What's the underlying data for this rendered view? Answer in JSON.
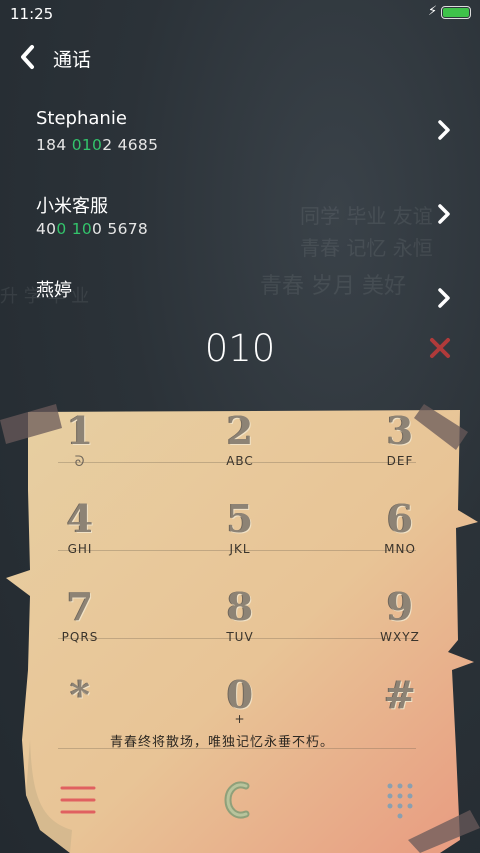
{
  "status": {
    "time": "11:25"
  },
  "header": {
    "title": "通话"
  },
  "contacts": [
    {
      "name": "Stephanie",
      "number_parts": [
        "184 ",
        "010",
        "2 4685"
      ]
    },
    {
      "name": "小米客服",
      "number_parts": [
        "40",
        "0 10",
        "0 5678"
      ]
    },
    {
      "name": "燕婷",
      "number_parts": [
        "",
        "",
        ""
      ]
    }
  ],
  "dialer": {
    "digits": "010",
    "keys": [
      {
        "num": "1",
        "letters": ""
      },
      {
        "num": "2",
        "letters": "ABC"
      },
      {
        "num": "3",
        "letters": "DEF"
      },
      {
        "num": "4",
        "letters": "GHI"
      },
      {
        "num": "5",
        "letters": "JKL"
      },
      {
        "num": "6",
        "letters": "MNO"
      },
      {
        "num": "7",
        "letters": "PQRS"
      },
      {
        "num": "8",
        "letters": "TUV"
      },
      {
        "num": "9",
        "letters": "WXYZ"
      },
      {
        "num": "*",
        "letters": ""
      },
      {
        "num": "0",
        "letters": "+"
      },
      {
        "num": "#",
        "letters": ""
      }
    ],
    "quote": "青春终将散场，唯独记忆永垂不朽。"
  },
  "colors": {
    "highlight": "#33c36b",
    "battery": "#3fc24a",
    "paper": "#e8c99a",
    "delete": "#b03a3a"
  }
}
